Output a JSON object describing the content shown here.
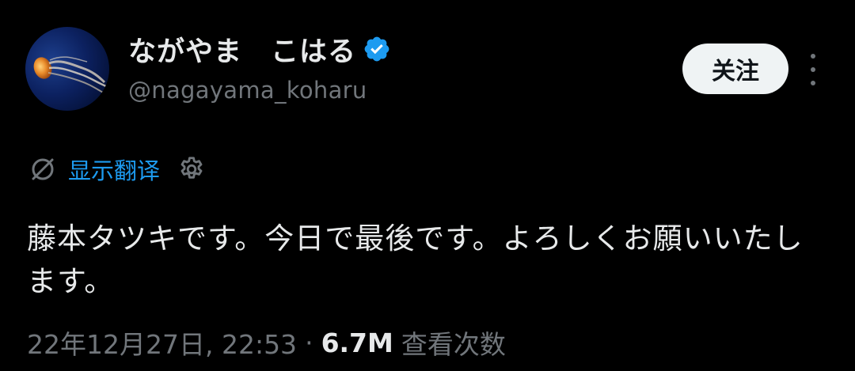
{
  "author": {
    "display_name": "ながやま　こはる",
    "handle": "@nagayama_koharu",
    "verified_icon": "verified-badge-icon",
    "avatar_icon": "jellyfish-avatar"
  },
  "header": {
    "follow_label": "关注",
    "more_icon": "more-vertical-icon"
  },
  "translate": {
    "label": "显示翻译",
    "icon": "translate-off-icon",
    "settings_icon": "gear-icon"
  },
  "tweet": {
    "text": "藤本タツキです。今日で最後です。よろしくお願いいたします。"
  },
  "meta": {
    "timestamp": "22年12月27日, 22:53",
    "separator": "·",
    "view_count": "6.7M",
    "view_label": "查看次数"
  },
  "colors": {
    "background": "#000000",
    "text_primary": "#e7e9ea",
    "text_secondary": "#71767b",
    "link": "#1d9bf0",
    "verified": "#1d9bf0",
    "button_bg": "#eff3f4"
  }
}
